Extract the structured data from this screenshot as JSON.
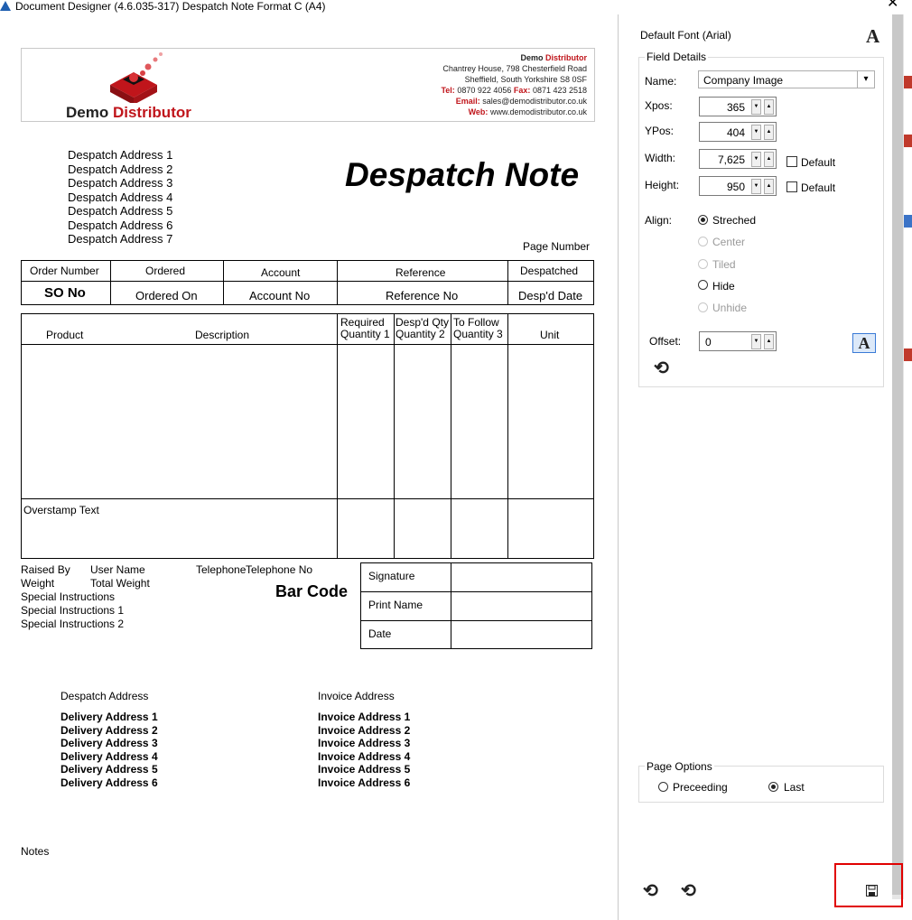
{
  "window": {
    "title": "Document Designer (4.6.035-317) Despatch Note Format C (A4)"
  },
  "company": {
    "logo_word1": "Demo ",
    "logo_word2": "Distributor",
    "name_word1": "Demo ",
    "name_word2": "Distributor",
    "address_line1": "Chantrey House, 798 Chesterfield Road",
    "address_line2": "Sheffield, South Yorkshire S8 0SF",
    "tel_label": "Tel:",
    "tel_value": "0870 922 4056",
    "fax_label": "Fax:",
    "fax_value": "0871 423 2518",
    "email_label": "Email:",
    "email_value": "sales@demodistributor.co.uk",
    "web_label": "Web:",
    "web_value": "www.demodistributor.co.uk"
  },
  "document": {
    "title": "Despatch Note",
    "despatch_address_lines": [
      "Despatch Address 1",
      "Despatch Address 2",
      "Despatch Address 3",
      "Despatch Address 4",
      "Despatch Address 5",
      "Despatch Address 6",
      "Despatch Address 7"
    ],
    "page_number": "Page Number",
    "order_table": {
      "headers": [
        "Order Number",
        "Ordered",
        "Account",
        "Reference",
        "Despatched"
      ],
      "values": [
        "SO No",
        "Ordered On",
        "Account No",
        "Reference No",
        "Desp'd Date"
      ]
    },
    "lines_table": {
      "product": "Product",
      "description": "Description",
      "required_l1": "Required",
      "required_l2": "Quantity 1",
      "despd_l1": "Desp'd Qty",
      "despd_l2": "Quantity 2",
      "follow_l1": "To Follow",
      "follow_l2": "Quantity 3",
      "unit": "Unit",
      "overstamp": "Overstamp Text"
    },
    "raised_by": "Raised By",
    "user_name": "User Name",
    "telephone": "Telephone",
    "telephone_no": "Telephone No",
    "weight": "Weight",
    "total_weight": "Total Weight",
    "special_instructions": [
      "Special Instructions",
      "Special Instructions 1",
      "Special Instructions 2"
    ],
    "bar_code": "Bar Code",
    "signature_rows": [
      "Signature",
      "Print Name",
      "Date"
    ],
    "despatch_address_heading": "Despatch Address",
    "delivery_address_lines": [
      "Delivery Address 1",
      "Delivery Address 2",
      "Delivery Address 3",
      "Delivery Address 4",
      "Delivery Address 5",
      "Delivery Address 6"
    ],
    "invoice_address_heading": "Invoice Address",
    "invoice_address_lines": [
      "Invoice Address 1",
      "Invoice Address 2",
      "Invoice Address 3",
      "Invoice Address 4",
      "Invoice Address 5",
      "Invoice Address 6"
    ],
    "notes": "Notes"
  },
  "panel": {
    "default_font": "Default Font (Arial)",
    "field_details_legend": "Field Details",
    "name_label": "Name:",
    "name_value": "Company Image",
    "xpos_label": "Xpos:",
    "xpos_value": "365",
    "ypos_label": "YPos:",
    "ypos_value": "404",
    "width_label": "Width:",
    "width_value": "7,625",
    "height_label": "Height:",
    "height_value": "950",
    "default_label": "Default",
    "align_label": "Align:",
    "align_options": [
      "Streched",
      "Center",
      "Tiled",
      "Hide",
      "Unhide"
    ],
    "align_selected": "Streched",
    "offset_label": "Offset:",
    "offset_value": "0",
    "page_options_legend": "Page Options",
    "page_options": [
      "Preceeding",
      "Last"
    ],
    "page_selected": "Last"
  },
  "colors": {
    "brand_red": "#c0151b",
    "highlight_red": "#e00000"
  },
  "icons": {
    "font": "font-icon",
    "refresh": "refresh-icon",
    "save": "save-icon",
    "close": "close-icon"
  }
}
